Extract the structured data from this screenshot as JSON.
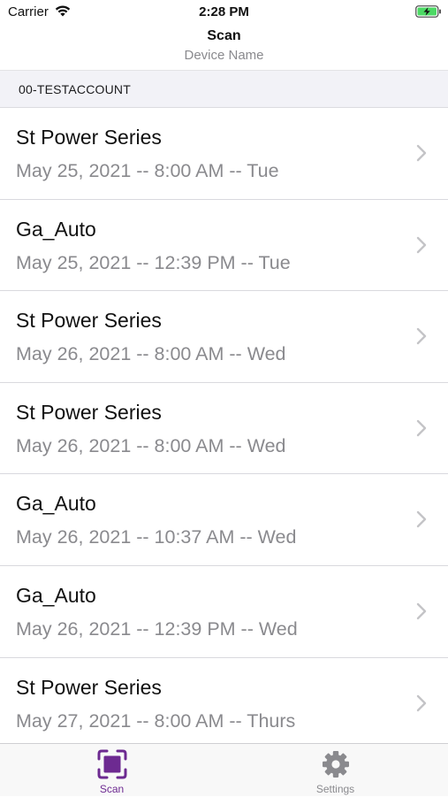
{
  "status_bar": {
    "carrier": "Carrier",
    "time": "2:28 PM",
    "wifi_icon": "wifi-icon",
    "battery_icon": "battery-charging-icon",
    "battery_color": "#4cd964"
  },
  "header": {
    "title": "Scan",
    "subtitle": "Device Name"
  },
  "section": {
    "label": "00-TESTACCOUNT"
  },
  "rows": [
    {
      "title": "St Power Series",
      "subtitle": "May 25, 2021 -- 8:00 AM -- Tue"
    },
    {
      "title": "Ga_Auto",
      "subtitle": "May 25, 2021 -- 12:39 PM -- Tue"
    },
    {
      "title": "St Power Series",
      "subtitle": "May 26, 2021 -- 8:00 AM -- Wed"
    },
    {
      "title": "St Power Series",
      "subtitle": "May 26, 2021 -- 8:00 AM -- Wed"
    },
    {
      "title": "Ga_Auto",
      "subtitle": "May 26, 2021 -- 10:37 AM -- Wed"
    },
    {
      "title": "Ga_Auto",
      "subtitle": "May 26, 2021 -- 12:39 PM -- Wed"
    },
    {
      "title": "St Power Series",
      "subtitle": "May 27, 2021 -- 8:00 AM -- Thurs"
    }
  ],
  "tab_bar": {
    "active_color": "#6d2a91",
    "inactive_color": "#8a8a8e",
    "tabs": [
      {
        "label": "Scan",
        "icon": "scan-icon",
        "active": true
      },
      {
        "label": "Settings",
        "icon": "gear-icon",
        "active": false
      }
    ]
  }
}
